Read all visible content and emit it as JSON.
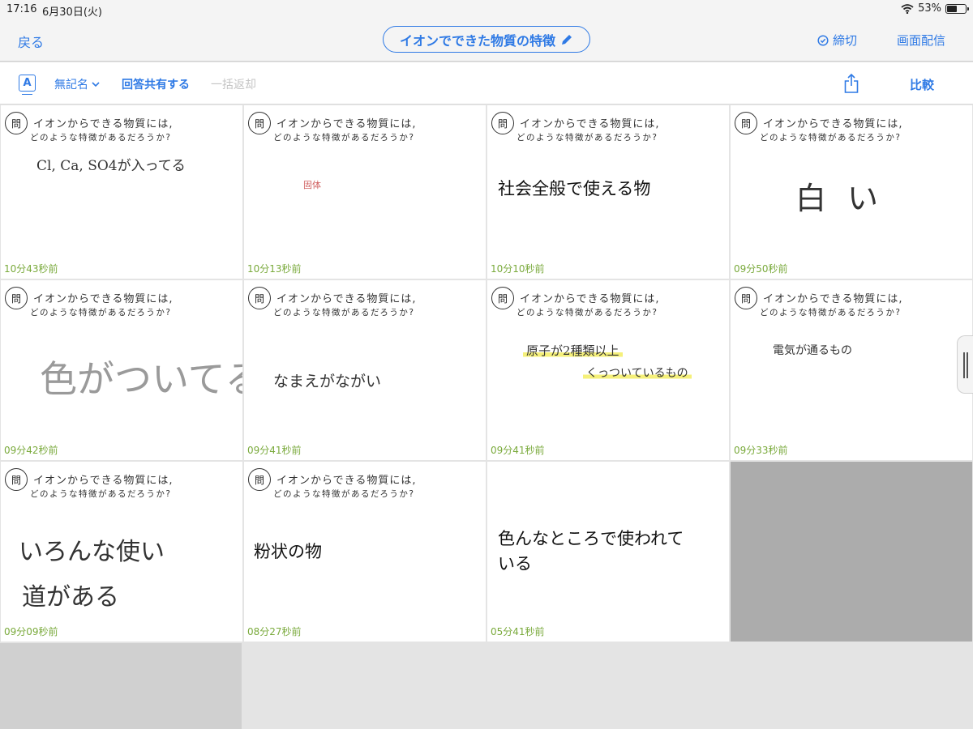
{
  "status_bar": {
    "time": "17:16",
    "date": "6月30日(火)",
    "battery": "53%",
    "battery_level": 0.53
  },
  "nav": {
    "back": "戻る",
    "title": "イオンでできた物質の特徴",
    "deadline": "締切",
    "broadcast": "画面配信"
  },
  "toolbar": {
    "font_icon": "A",
    "anonymous": "無記名",
    "share_answers": "回答共有する",
    "bulk_return": "一括返却",
    "compare": "比較"
  },
  "question": {
    "mark": "問",
    "line1": "イオンからできる物質には,",
    "line2": "どのような特徴があるだろうか?"
  },
  "cards": [
    {
      "answer": "Cl, Ca, SO4が入ってる",
      "timestamp": "10分43秒前"
    },
    {
      "answer": "固体",
      "timestamp": "10分13秒前"
    },
    {
      "answer": "社会全般で使える物",
      "timestamp": "10分10秒前"
    },
    {
      "answer": "白い",
      "timestamp": "09分50秒前"
    },
    {
      "answer": "色がついてる",
      "timestamp": "09分42秒前"
    },
    {
      "answer": "なまえがながい",
      "timestamp": "09分41秒前"
    },
    {
      "answer_lines": [
        "原子が2種類以上",
        "くっついているもの"
      ],
      "timestamp": "09分41秒前"
    },
    {
      "answer": "電気が通るもの",
      "timestamp": "09分33秒前"
    },
    {
      "answer_lines": [
        "いろんな使い",
        "道がある"
      ],
      "timestamp": "09分09秒前"
    },
    {
      "answer": "粉状の物",
      "timestamp": "08分27秒前"
    },
    {
      "answer_lines": [
        "色んなところで使われて",
        "いる"
      ],
      "timestamp": "05分41秒前"
    }
  ],
  "colors": {
    "accent": "#2f7ae5",
    "timestamp": "#7aaa3c",
    "highlight": "#f5f07a",
    "empty_slot": "#acacac"
  }
}
